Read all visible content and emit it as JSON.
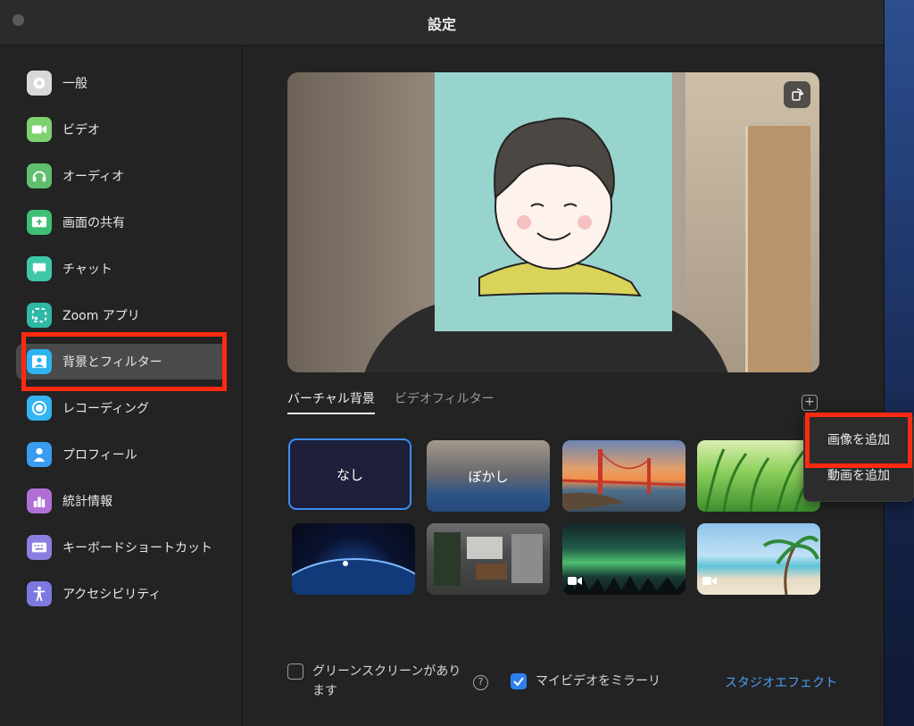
{
  "window": {
    "title": "設定"
  },
  "sidebar": {
    "items": [
      {
        "label": "一般",
        "icon": "gear-icon",
        "color": "#d9d9d9"
      },
      {
        "label": "ビデオ",
        "icon": "video-camera-icon",
        "color": "#7ed16f"
      },
      {
        "label": "オーディオ",
        "icon": "headphones-icon",
        "color": "#5fbf6f"
      },
      {
        "label": "画面の共有",
        "icon": "share-screen-icon",
        "color": "#3fbf74"
      },
      {
        "label": "チャット",
        "icon": "chat-icon",
        "color": "#3fc7a8"
      },
      {
        "label": "Zoom アプリ",
        "icon": "apps-icon",
        "color": "#2fb8a6"
      },
      {
        "label": "背景とフィルター",
        "icon": "background-person-icon",
        "color": "#2eb3f0"
      },
      {
        "label": "レコーディング",
        "icon": "record-icon",
        "color": "#34b4f2"
      },
      {
        "label": "プロフィール",
        "icon": "profile-icon",
        "color": "#3a9cf0"
      },
      {
        "label": "統計情報",
        "icon": "statistics-icon",
        "color": "#b06fd6"
      },
      {
        "label": "キーボードショートカット",
        "icon": "keyboard-icon",
        "color": "#8a7fe0"
      },
      {
        "label": "アクセシビリティ",
        "icon": "accessibility-icon",
        "color": "#7c79e0"
      }
    ],
    "active_index": 6
  },
  "tabs": [
    {
      "label": "バーチャル背景",
      "active": true
    },
    {
      "label": "ビデオフィルター",
      "active": false
    }
  ],
  "backgrounds": [
    {
      "label": "なし",
      "kind": "none",
      "selected": true
    },
    {
      "label": "ぼかし",
      "kind": "blur"
    },
    {
      "label": "",
      "kind": "golden-gate-bridge"
    },
    {
      "label": "",
      "kind": "grass"
    },
    {
      "label": "",
      "kind": "earth-from-space"
    },
    {
      "label": "",
      "kind": "office-interior"
    },
    {
      "label": "",
      "kind": "aurora",
      "video": true
    },
    {
      "label": "",
      "kind": "beach",
      "video": true
    }
  ],
  "add_menu": {
    "items": [
      "画像を追加",
      "動画を追加"
    ]
  },
  "footer": {
    "green_screen_label": "グリーンスクリーンがあります",
    "green_screen_checked": false,
    "mirror_label": "マイビデオをミラーリ",
    "mirror_checked": true,
    "studio_effects_link": "スタジオエフェクト"
  },
  "colors": {
    "accent": "#3a8cf0",
    "annotation_red": "#ff2a12",
    "link": "#4d9cf7"
  }
}
